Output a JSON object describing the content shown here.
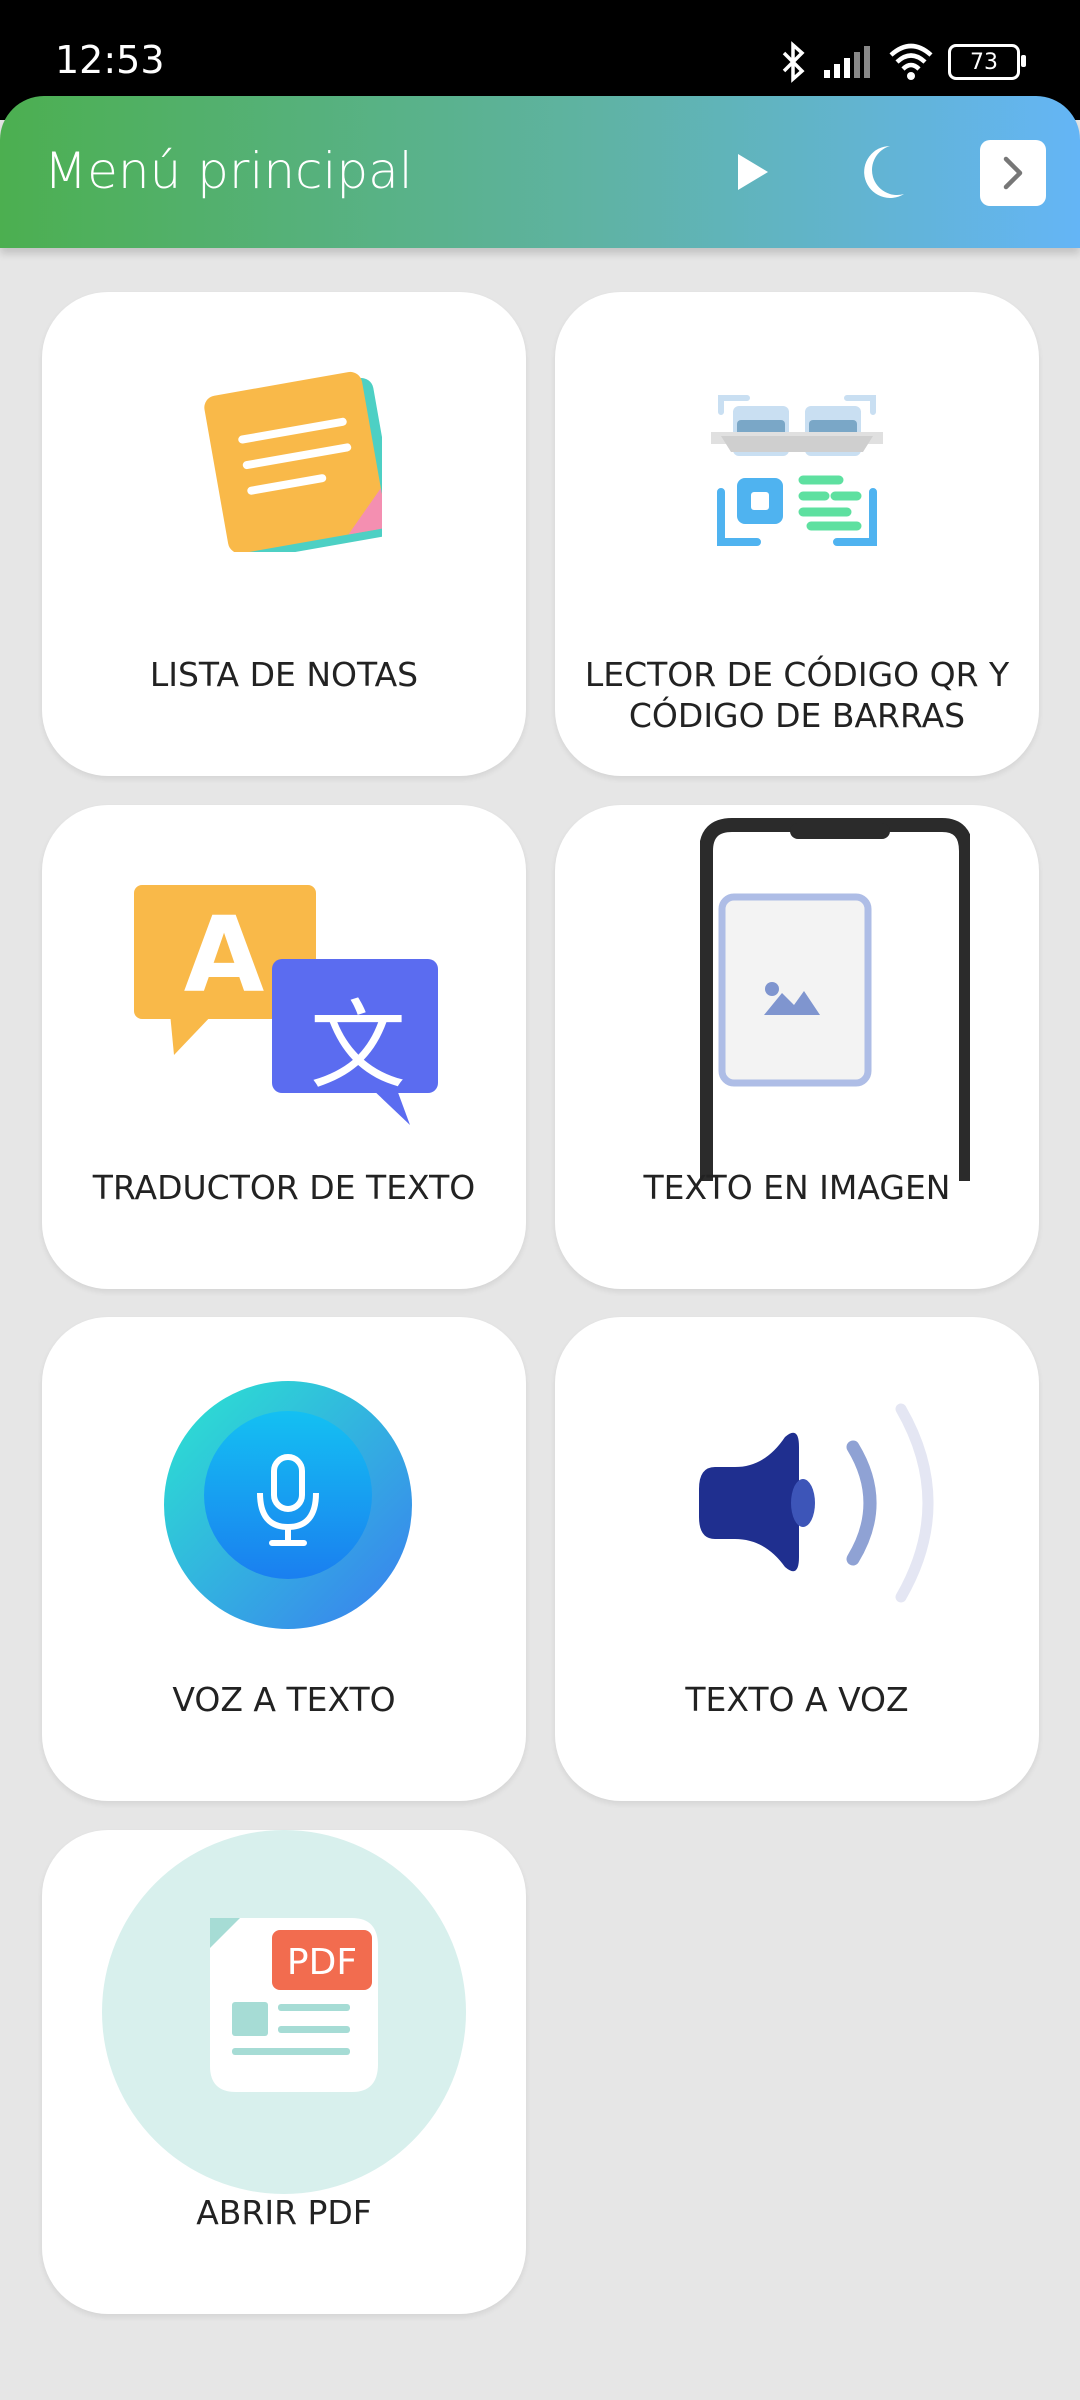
{
  "status_bar": {
    "time": "12:53",
    "battery": "73"
  },
  "app_bar": {
    "title": "Menú principal",
    "actions": [
      "play-icon",
      "moon-icon",
      "chevron-right-icon"
    ],
    "gradient_colors": [
      "#4caf50",
      "#5fb3a3",
      "#64b5f6"
    ]
  },
  "tiles": [
    {
      "label": "LISTA DE NOTAS",
      "icon": "notes-icon"
    },
    {
      "label": "LECTOR DE CÓDIGO QR Y CÓDIGO DE BARRAS",
      "icon": "qr-scanner-icon"
    },
    {
      "label": "TRADUCTOR DE TEXTO",
      "icon": "translate-icon"
    },
    {
      "label": "TEXTO EN IMAGEN",
      "icon": "phone-image-icon"
    },
    {
      "label": "VOZ A TEXTO",
      "icon": "microphone-icon"
    },
    {
      "label": "TEXTO A VOZ",
      "icon": "speaker-icon"
    },
    {
      "label": "ABRIR PDF",
      "icon": "pdf-icon",
      "badge": "PDF"
    }
  ]
}
